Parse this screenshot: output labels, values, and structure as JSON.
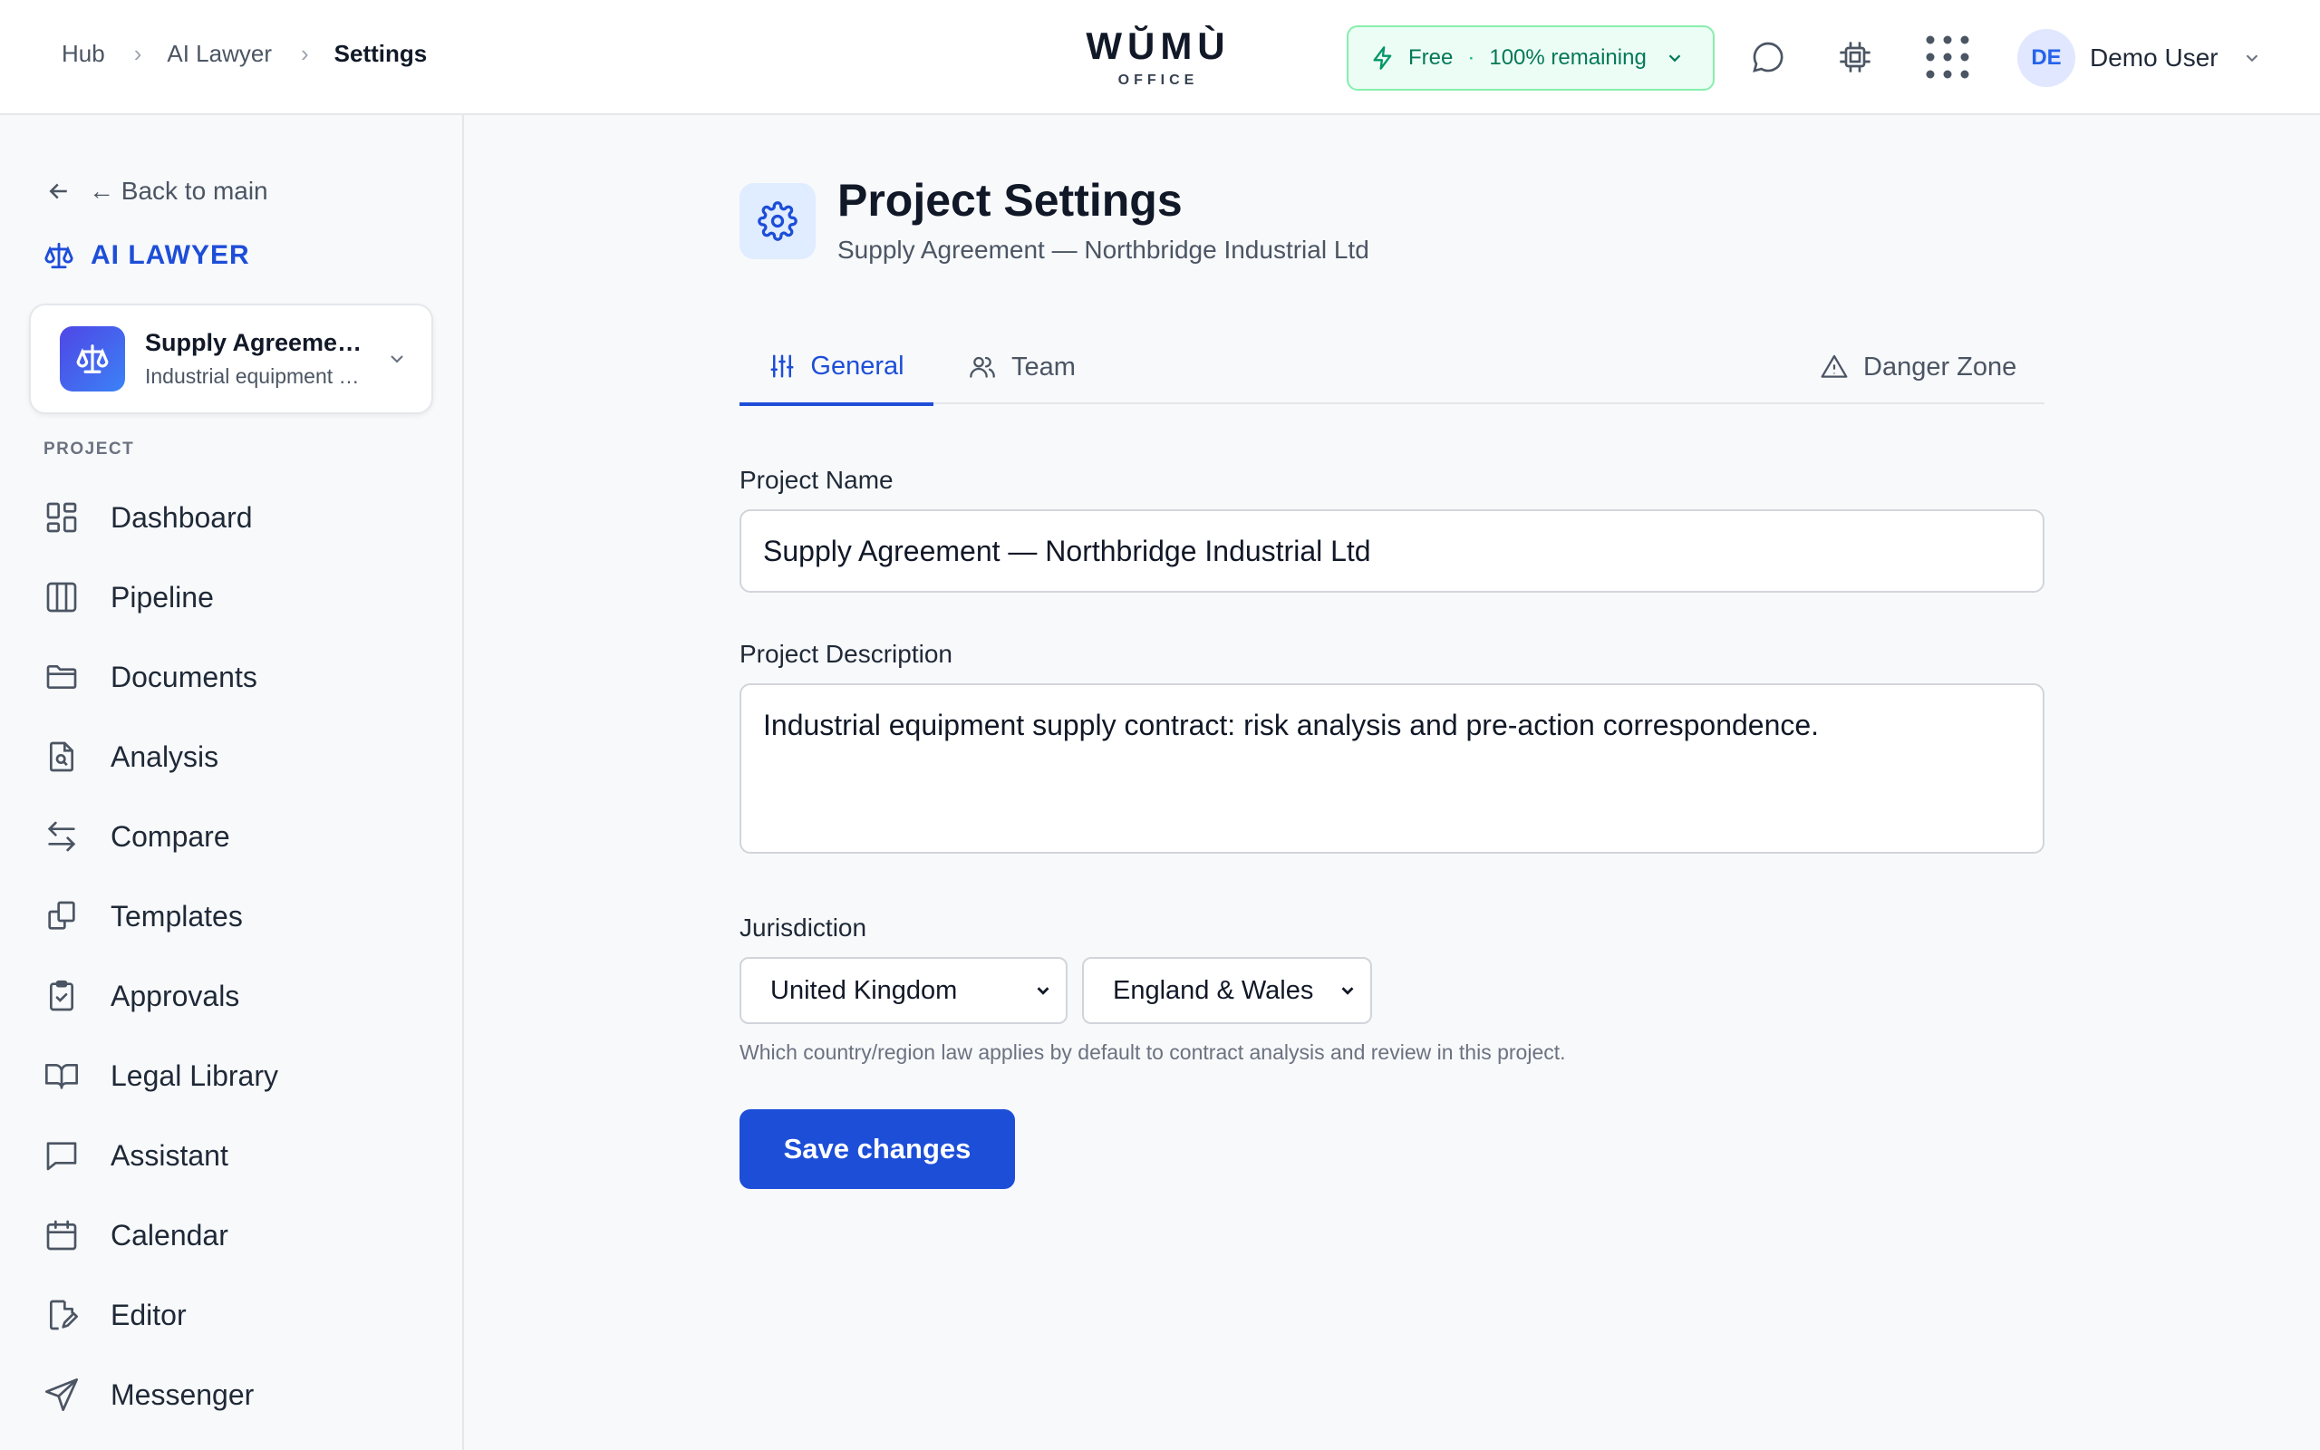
{
  "header": {
    "breadcrumb": [
      "Hub",
      "AI Lawyer",
      "Settings"
    ],
    "logo": {
      "word": "WŬMÙ",
      "sub": "OFFICE"
    },
    "plan": {
      "name": "Free",
      "remaining": "100% remaining"
    },
    "user": {
      "initials": "DE",
      "name": "Demo User"
    }
  },
  "sidebar": {
    "back_label": "← Back to main",
    "app_title": "AI LAWYER",
    "project": {
      "name": "Supply Agreement — Northbridge Industrial Ltd",
      "subtitle": "Industrial equipment supply contract"
    },
    "section_label": "PROJECT",
    "items": [
      {
        "label": "Dashboard",
        "icon": "dashboard-icon"
      },
      {
        "label": "Pipeline",
        "icon": "pipeline-icon"
      },
      {
        "label": "Documents",
        "icon": "folder-icon"
      },
      {
        "label": "Analysis",
        "icon": "document-search-icon"
      },
      {
        "label": "Compare",
        "icon": "compare-arrows-icon"
      },
      {
        "label": "Templates",
        "icon": "templates-icon"
      },
      {
        "label": "Approvals",
        "icon": "clipboard-check-icon"
      },
      {
        "label": "Legal Library",
        "icon": "book-icon"
      },
      {
        "label": "Assistant",
        "icon": "chat-icon"
      },
      {
        "label": "Calendar",
        "icon": "calendar-icon"
      },
      {
        "label": "Editor",
        "icon": "edit-document-icon"
      },
      {
        "label": "Messenger",
        "icon": "send-icon"
      }
    ]
  },
  "main": {
    "title": "Project Settings",
    "subtitle": "Supply Agreement — Northbridge Industrial Ltd",
    "tabs": [
      {
        "label": "General",
        "active": true
      },
      {
        "label": "Team",
        "active": false
      },
      {
        "label": "Danger Zone",
        "active": false
      }
    ],
    "form": {
      "name_label": "Project Name",
      "name_value": "Supply Agreement — Northbridge Industrial Ltd",
      "description_label": "Project Description",
      "description_value": "Industrial equipment supply contract: risk analysis and pre-action correspondence.",
      "jurisdiction_label": "Jurisdiction",
      "country": "United Kingdom",
      "region": "England & Wales",
      "hint": "Which country/region law applies by default to contract analysis and review in this project.",
      "save_label": "Save changes"
    }
  },
  "colors": {
    "accent": "#1d4ed8",
    "plan_bg": "#ecfdf5",
    "plan_text": "#047857"
  }
}
